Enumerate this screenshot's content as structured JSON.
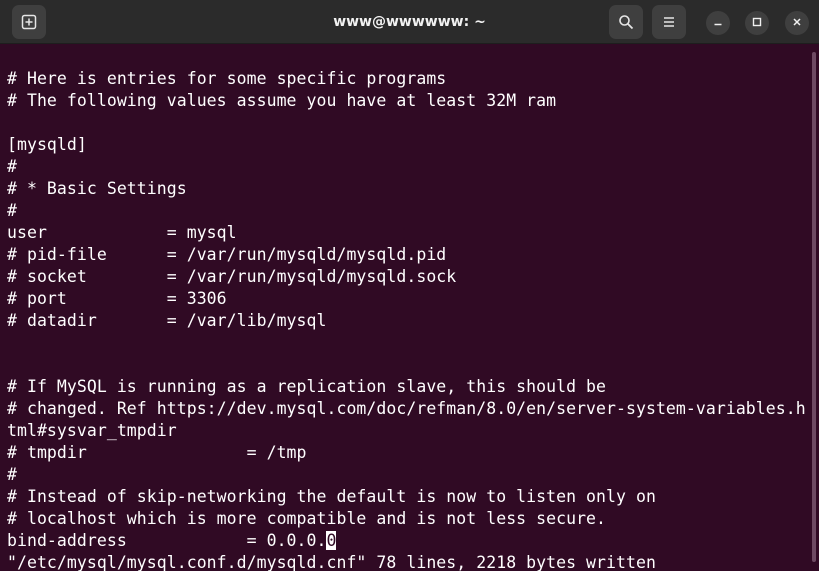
{
  "window": {
    "title": "www@wwwwww: ~"
  },
  "icons": {
    "new_tab": "new-tab-icon",
    "search": "search-icon",
    "menu": "hamburger-menu-icon",
    "minimize": "minimize-icon",
    "maximize": "maximize-icon",
    "close": "close-icon"
  },
  "colors": {
    "terminal_background": "#300a24",
    "terminal_text": "#ffffff",
    "titlebar": "#2b2b2b"
  },
  "terminal": {
    "lines": [
      "# Here is entries for some specific programs",
      "# The following values assume you have at least 32M ram",
      "",
      "[mysqld]",
      "#",
      "# * Basic Settings",
      "#",
      "user            = mysql",
      "# pid-file      = /var/run/mysqld/mysqld.pid",
      "# socket        = /var/run/mysqld/mysqld.sock",
      "# port          = 3306",
      "# datadir       = /var/lib/mysql",
      "",
      "",
      "# If MySQL is running as a replication slave, this should be",
      "# changed. Ref https://dev.mysql.com/doc/refman/8.0/en/server-system-variables.h",
      "tml#sysvar_tmpdir",
      "# tmpdir                = /tmp",
      "#",
      "# Instead of skip-networking the default is now to listen only on",
      "# localhost which is more compatible and is not less secure.",
      "bind-address            = 0.0.0.",
      "\"/etc/mysql/mysql.conf.d/mysqld.cnf\" 78 lines, 2218 bytes written"
    ],
    "cursor_char": "0"
  }
}
